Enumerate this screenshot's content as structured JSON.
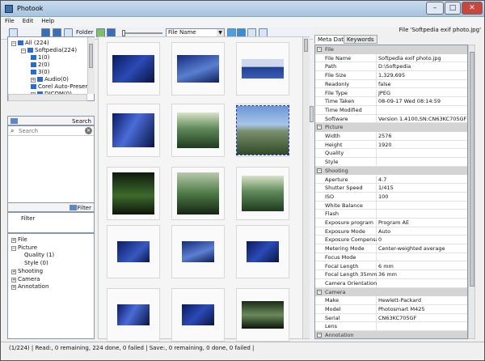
{
  "window": {
    "title": "Photook"
  },
  "menu": [
    "File",
    "Edit",
    "Help"
  ],
  "toolbar": {
    "folder_label": "Folder",
    "sort_value": "File Name"
  },
  "file_caption": "File 'Softpedia exif photo.jpg'",
  "tabs": [
    "Meta Data",
    "Keywords"
  ],
  "tree": [
    {
      "label": "All (224)",
      "level": 0
    },
    {
      "label": "Softpedia(224)",
      "level": 1
    },
    {
      "label": "1(0)",
      "level": 2
    },
    {
      "label": "2(0)",
      "level": 2
    },
    {
      "label": "3(0)",
      "level": 2
    },
    {
      "label": "Audio(0)",
      "level": 2
    },
    {
      "label": "Corel Auto-Preser",
      "level": 2
    },
    {
      "label": "DICOM(0)",
      "level": 2
    }
  ],
  "search": {
    "header_label": "Search",
    "placeholder": "Search"
  },
  "filter": {
    "header_label": "Filter",
    "box_label": "Filter"
  },
  "filter_tree": [
    {
      "label": "File",
      "level": 0
    },
    {
      "label": "Picture",
      "level": 0
    },
    {
      "label": "Quality (1)",
      "level": 1
    },
    {
      "label": "Style  (0)",
      "level": 1
    },
    {
      "label": "Shooting",
      "level": 0
    },
    {
      "label": "Camera",
      "level": 0
    },
    {
      "label": "Annotation",
      "level": 0
    }
  ],
  "properties": [
    {
      "cat": "File"
    },
    {
      "k": "File Name",
      "v": "Softpedia exif photo.jpg"
    },
    {
      "k": "Path",
      "v": "D:\\Softpedia"
    },
    {
      "k": "File Size",
      "v": "1,329,695"
    },
    {
      "k": "Readonly",
      "v": "false"
    },
    {
      "k": "File Type",
      "v": "JPEG"
    },
    {
      "k": "Time Taken",
      "v": "08-09-17 Wed 08:14:59"
    },
    {
      "k": "Time Modified",
      "v": ""
    },
    {
      "k": "Software",
      "v": "Version 1.4100,SN:CN63KC705GF"
    },
    {
      "cat": "Picture"
    },
    {
      "k": "Width",
      "v": "2576"
    },
    {
      "k": "Height",
      "v": "1920"
    },
    {
      "k": "Quality",
      "v": ""
    },
    {
      "k": "Style",
      "v": ""
    },
    {
      "cat": "Shooting"
    },
    {
      "k": "Aperture",
      "v": "4.7"
    },
    {
      "k": "Shutter Speed",
      "v": "1/415"
    },
    {
      "k": "ISO",
      "v": "100"
    },
    {
      "k": "White Balance",
      "v": ""
    },
    {
      "k": "Flash",
      "v": ""
    },
    {
      "k": "Exposure program",
      "v": "Program AE"
    },
    {
      "k": "Exposure Mode",
      "v": "Auto"
    },
    {
      "k": "Exposure Compensati",
      "v": "0"
    },
    {
      "k": "Metering Mode",
      "v": "Center-weighted average"
    },
    {
      "k": "Focus Mode",
      "v": ""
    },
    {
      "k": "Focal Length",
      "v": "6 mm"
    },
    {
      "k": "Focal Length 35mm",
      "v": "36 mm"
    },
    {
      "k": "Camera Orientation",
      "v": ""
    },
    {
      "cat": "Camera"
    },
    {
      "k": "Make",
      "v": "Hewlett-Packard"
    },
    {
      "k": "Model",
      "v": "Photosmart M425"
    },
    {
      "k": "Serial",
      "v": "CN63KC705GF"
    },
    {
      "k": "Lens",
      "v": ""
    },
    {
      "cat": "Annotation"
    }
  ],
  "status": "(1/224) | Read:, 0 remaining, 224 done, 0 failed | Save:, 0 remaining, 0 done, 0 failed |",
  "thumbnails": [
    {
      "kind": "blue-wall"
    },
    {
      "kind": "blue-site"
    },
    {
      "kind": "blue-pale"
    },
    {
      "kind": "blue-swirl"
    },
    {
      "kind": "forest"
    },
    {
      "kind": "mountain",
      "selected": true
    },
    {
      "kind": "forest-dark"
    },
    {
      "kind": "forest-mist"
    },
    {
      "kind": "forest"
    },
    {
      "kind": "blue-small"
    },
    {
      "kind": "blue-site-small"
    },
    {
      "kind": "blue-wall-small"
    },
    {
      "kind": "blue-swirl-small"
    },
    {
      "kind": "blue-wall-small"
    },
    {
      "kind": "forest-dark-small"
    }
  ]
}
